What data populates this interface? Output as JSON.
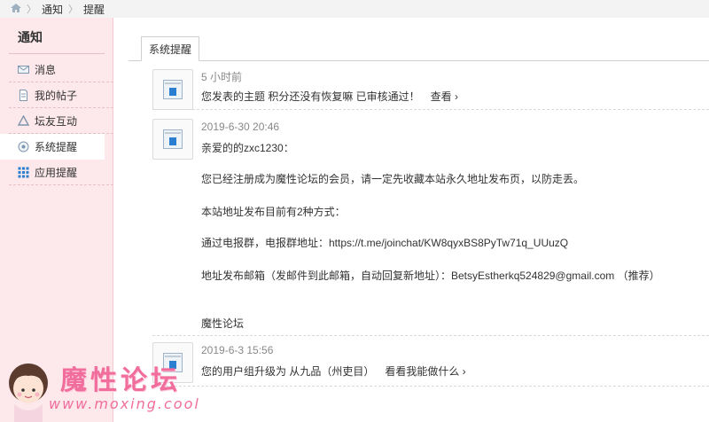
{
  "breadcrumb": {
    "items": [
      "通知",
      "提醒"
    ]
  },
  "sidebar": {
    "title": "通知",
    "items": [
      {
        "label": "消息",
        "icon": "envelope-icon"
      },
      {
        "label": "我的帖子",
        "icon": "document-icon"
      },
      {
        "label": "坛友互动",
        "icon": "recycle-icon"
      },
      {
        "label": "系统提醒",
        "icon": "gear-icon",
        "active": true
      },
      {
        "label": "应用提醒",
        "icon": "grid-icon"
      }
    ]
  },
  "tab": {
    "label": "系统提醒"
  },
  "notices": [
    {
      "time": "5 小时前",
      "text": "您发表的主题 积分还没有恢复嘛 已审核通过！",
      "link": "查看 ›"
    },
    {
      "time": "2019-6-30 20:46",
      "lines": [
        "亲爱的的zxc1230：",
        "您已经注册成为魔性论坛的会员，请一定先收藏本站永久地址发布页，以防走丢。",
        "本站地址发布目前有2种方式：",
        "通过电报群，电报群地址：https://t.me/joinchat/KW8qyxBS8PyTw71q_UUuzQ",
        "地址发布邮箱（发邮件到此邮箱，自动回复新地址）：BetsyEstherkq524829@gmail.com （推荐）",
        "魔性论坛"
      ]
    },
    {
      "time": "2019-6-3 15:56",
      "text": "您的用户组升级为 从九品（州吏目）",
      "link": "看看我能做什么 ›"
    }
  ],
  "watermark": {
    "title": "魔性论坛",
    "url": "www.moxing.cool"
  },
  "colors": {
    "sidebar_bg": "#fde8ec",
    "watermark": "#f06d9c"
  }
}
